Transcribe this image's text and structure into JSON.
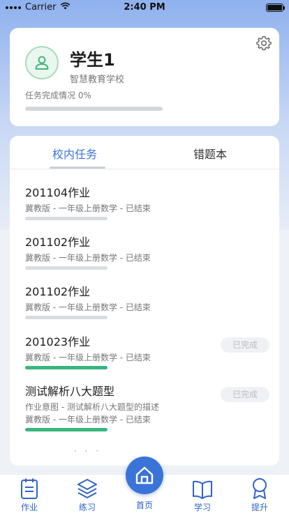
{
  "status_bar": {
    "carrier": "Carrier",
    "time": "2:40 PM"
  },
  "profile": {
    "name": "学生1",
    "school": "智慧教育学校",
    "progress_label": "任务完成情况 0%",
    "progress_value": 0
  },
  "tabs": [
    {
      "label": "校内任务",
      "active": true
    },
    {
      "label": "错题本",
      "active": false
    }
  ],
  "tasks": [
    {
      "title": "201104作业",
      "lines": [
        "冀教版 - 一年级上册数学 - 已结束"
      ],
      "progress": 0,
      "badge": ""
    },
    {
      "title": "201102作业",
      "lines": [
        "冀教版 - 一年级上册数学 - 已结束"
      ],
      "progress": 0,
      "badge": ""
    },
    {
      "title": "201102作业",
      "lines": [
        "冀教版 - 一年级上册数学 - 已结束"
      ],
      "progress": 0,
      "badge": ""
    },
    {
      "title": "201023作业",
      "lines": [
        "冀教版 - 一年级上册数学 - 已结束"
      ],
      "progress": 1,
      "badge": "已完成"
    },
    {
      "title": "测试解析八大题型",
      "lines": [
        "作业意图 - 测试解析八大题型的描述",
        "冀教版 - 一年级上册数学 - 已结束"
      ],
      "progress": 1,
      "badge": "已完成"
    }
  ],
  "nav": {
    "homework": "作业",
    "practice": "练习",
    "home": "首页",
    "study": "学习",
    "improve": "提升"
  },
  "colors": {
    "accent": "#3a74d8",
    "success": "#38b57c",
    "track": "#d9dce1"
  }
}
